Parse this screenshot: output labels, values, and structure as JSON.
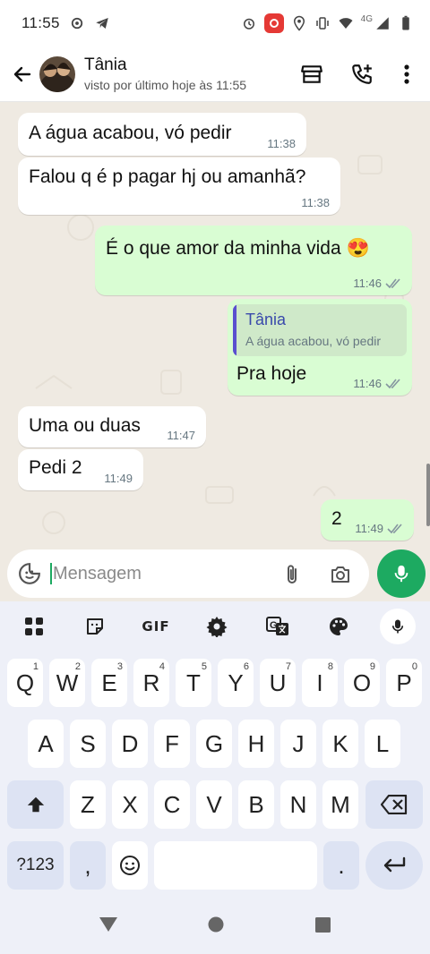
{
  "status_bar": {
    "time": "11:55",
    "network": "4G"
  },
  "header": {
    "contact_name": "Tânia",
    "last_seen": "visto por último hoje às 11:55"
  },
  "messages": [
    {
      "text": "A água acabou, vó pedir",
      "time": "11:38"
    },
    {
      "text": "Falou q é p pagar hj ou amanhã?",
      "time": "11:38"
    },
    {
      "text": "É o que amor da minha vida 😍",
      "time": "11:46"
    },
    {
      "quote_name": "Tânia",
      "quote_text": "A água acabou, vó pedir",
      "text": "Pra hoje",
      "time": "11:46"
    },
    {
      "text": "Uma ou duas",
      "time": "11:47"
    },
    {
      "text": "Pedi 2",
      "time": "11:49"
    },
    {
      "text": "2",
      "time": "11:49"
    }
  ],
  "composer": {
    "placeholder": "Mensagem"
  },
  "keyboard": {
    "gif_label": "GIF",
    "row1": [
      {
        "k": "Q",
        "h": "1"
      },
      {
        "k": "W",
        "h": "2"
      },
      {
        "k": "E",
        "h": "3"
      },
      {
        "k": "R",
        "h": "4"
      },
      {
        "k": "T",
        "h": "5"
      },
      {
        "k": "Y",
        "h": "6"
      },
      {
        "k": "U",
        "h": "7"
      },
      {
        "k": "I",
        "h": "8"
      },
      {
        "k": "O",
        "h": "9"
      },
      {
        "k": "P",
        "h": "0"
      }
    ],
    "row2": [
      "A",
      "S",
      "D",
      "F",
      "G",
      "H",
      "J",
      "K",
      "L"
    ],
    "row3": [
      "Z",
      "X",
      "C",
      "V",
      "B",
      "N",
      "M"
    ],
    "symbols_label": "?123",
    "comma": ",",
    "period": "."
  },
  "colors": {
    "accent": "#1daa61",
    "outgoing": "#d9fdd3",
    "incoming": "#ffffff",
    "quote_bar": "#5a4fcf"
  }
}
